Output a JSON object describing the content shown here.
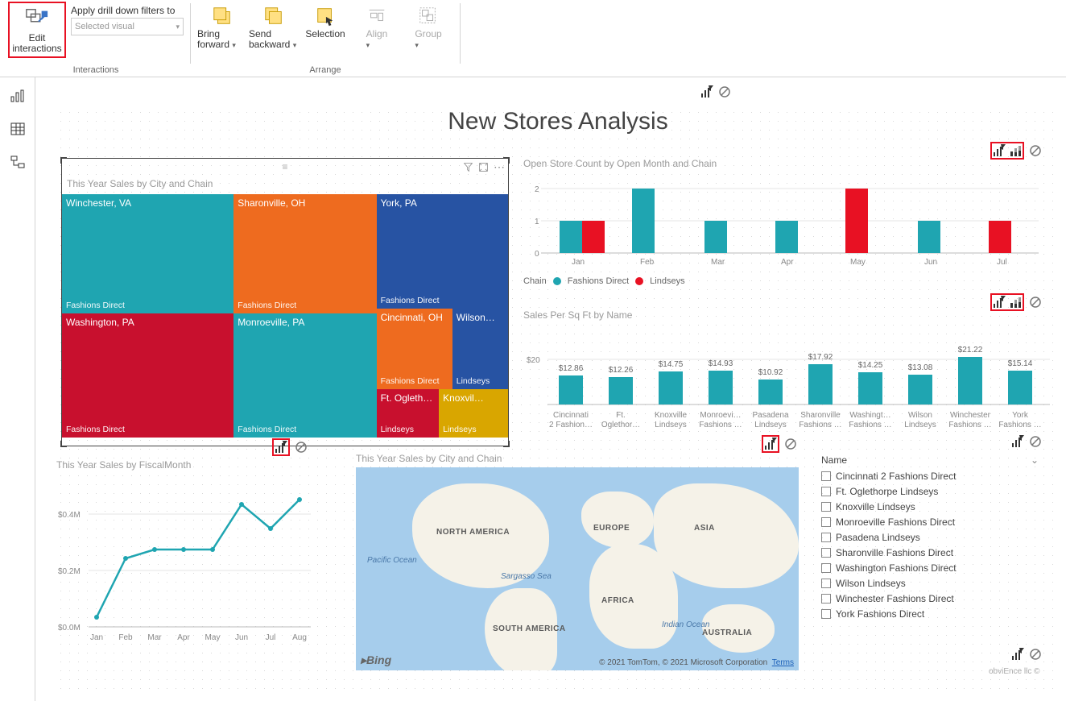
{
  "ribbon": {
    "edit_interactions": "Edit interactions",
    "drill_label": "Apply drill down filters to",
    "drill_placeholder": "Selected visual",
    "interactions_group": "Interactions",
    "bring_forward": "Bring forward",
    "send_backward": "Send backward",
    "selection": "Selection",
    "align": "Align",
    "group": "Group",
    "arrange_group": "Arrange"
  },
  "page_title": "New Stores Analysis",
  "treemap": {
    "title": "This Year Sales by City and Chain",
    "cells": {
      "winchester": {
        "city": "Winchester, VA",
        "chain": "Fashions Direct"
      },
      "sharonville": {
        "city": "Sharonville, OH",
        "chain": "Fashions Direct"
      },
      "york": {
        "city": "York, PA",
        "chain": "Fashions Direct"
      },
      "washington": {
        "city": "Washington, PA",
        "chain": "Fashions Direct"
      },
      "monroeville": {
        "city": "Monroeville, PA",
        "chain": "Fashions Direct"
      },
      "cincinnati": {
        "city": "Cincinnati, OH",
        "chain": "Fashions Direct"
      },
      "wilson": {
        "city": "Wilson…",
        "chain": "Lindseys"
      },
      "ftog": {
        "city": "Ft. Ogleth…",
        "chain": "Lindseys"
      },
      "knox": {
        "city": "Knoxvil…",
        "chain": "Lindseys"
      }
    }
  },
  "storecount": {
    "title": "Open Store Count by Open Month and Chain",
    "legend_label": "Chain",
    "series_a": "Fashions Direct",
    "series_b": "Lindseys"
  },
  "sqft": {
    "title": "Sales Per Sq Ft by Name"
  },
  "linechart": {
    "title": "This Year Sales by FiscalMonth"
  },
  "map": {
    "title": "This Year Sales by City and Chain",
    "bing": "Bing",
    "credits": "© 2021 TomTom, © 2021 Microsoft Corporation",
    "terms": "Terms",
    "labels": {
      "na": "NORTH AMERICA",
      "sa": "SOUTH AMERICA",
      "eu": "EUROPE",
      "af": "AFRICA",
      "as": "ASIA",
      "au": "AUSTRALIA",
      "pac": "Pacific Ocean",
      "sarg": "Sargasso Sea",
      "ind": "Indian Ocean"
    }
  },
  "slicer": {
    "header": "Name",
    "items": [
      "Cincinnati 2 Fashions Direct",
      "Ft. Oglethorpe Lindseys",
      "Knoxville Lindseys",
      "Monroeville Fashions Direct",
      "Pasadena Lindseys",
      "Sharonville Fashions Direct",
      "Washington Fashions Direct",
      "Wilson Lindseys",
      "Winchester Fashions Direct",
      "York Fashions Direct"
    ]
  },
  "attribution": "obviEnce llc ©",
  "chart_data": [
    {
      "type": "bar",
      "title": "Open Store Count by Open Month and Chain",
      "categories": [
        "Jan",
        "Feb",
        "Mar",
        "Apr",
        "May",
        "Jun",
        "Jul"
      ],
      "series": [
        {
          "name": "Fashions Direct",
          "values": [
            1,
            2,
            1,
            1,
            0,
            1,
            0
          ]
        },
        {
          "name": "Lindseys",
          "values": [
            1,
            0,
            0,
            0,
            2,
            0,
            1
          ]
        }
      ],
      "ylim": [
        0,
        2
      ]
    },
    {
      "type": "bar",
      "title": "Sales Per Sq Ft by Name",
      "categories": [
        "Cincinnati 2 Fashion…",
        "Ft. Oglethor…",
        "Knoxville Lindseys",
        "Monroevi… Fashions …",
        "Pasadena Lindseys",
        "Sharonville Fashions …",
        "Washingt… Fashions …",
        "Wilson Lindseys",
        "Winchester Fashions …",
        "York Fashions …"
      ],
      "values": [
        12.86,
        12.26,
        14.75,
        14.93,
        10.92,
        17.92,
        14.25,
        13.08,
        21.22,
        15.14
      ],
      "ylim": [
        0,
        22
      ],
      "ylabel": "$"
    },
    {
      "type": "line",
      "title": "This Year Sales by FiscalMonth",
      "categories": [
        "Jan",
        "Feb",
        "Mar",
        "Apr",
        "May",
        "Jun",
        "Jul",
        "Aug"
      ],
      "values": [
        0.06,
        0.25,
        0.28,
        0.28,
        0.28,
        0.44,
        0.36,
        0.46
      ],
      "ylim": [
        0,
        0.5
      ],
      "ylabel": "$M"
    }
  ],
  "colors": {
    "teal": "#1fa5b1",
    "red": "#e81123",
    "orange": "#ee6b1f",
    "blue": "#2753a3",
    "gold": "#d9a600",
    "darkred": "#c8102e"
  }
}
